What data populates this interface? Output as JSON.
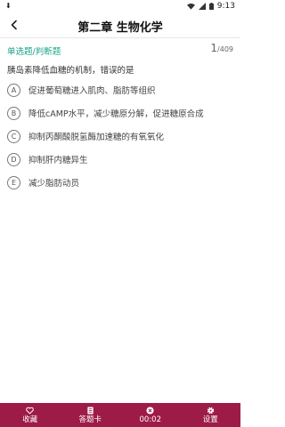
{
  "status_bar": {
    "time": "9:13",
    "left_icon": "download-icon",
    "icons": [
      "wifi-icon",
      "signal-icon",
      "battery-icon"
    ]
  },
  "header": {
    "title": "第二章 生物化学",
    "back_icon": "chevron-left-icon"
  },
  "question": {
    "type_label": "单选题/判断题",
    "current": "1",
    "total": "/409",
    "text": "胰岛素降低血糖的机制，错误的是",
    "options": [
      {
        "letter": "A",
        "text": "促进葡萄糖进入肌肉、脂肪等组织"
      },
      {
        "letter": "B",
        "text": "降低cAMP水平，减少糖原分解，促进糖原合成"
      },
      {
        "letter": "C",
        "text": "抑制丙酮酸脱氢酶加速糖的有氧氧化"
      },
      {
        "letter": "D",
        "text": "抑制肝内糖异生"
      },
      {
        "letter": "E",
        "text": "减少脂肪动员"
      }
    ]
  },
  "bottom_bar": {
    "background": "#9d1b47",
    "tabs": [
      {
        "label": "收藏",
        "icon": "heart-icon"
      },
      {
        "label": "答题卡",
        "icon": "answer-card-icon"
      },
      {
        "label": "00:02",
        "icon": "timer-icon"
      },
      {
        "label": "设置",
        "icon": "gear-icon"
      }
    ]
  },
  "colors": {
    "accent": "#17a589",
    "bar": "#9d1b47"
  }
}
